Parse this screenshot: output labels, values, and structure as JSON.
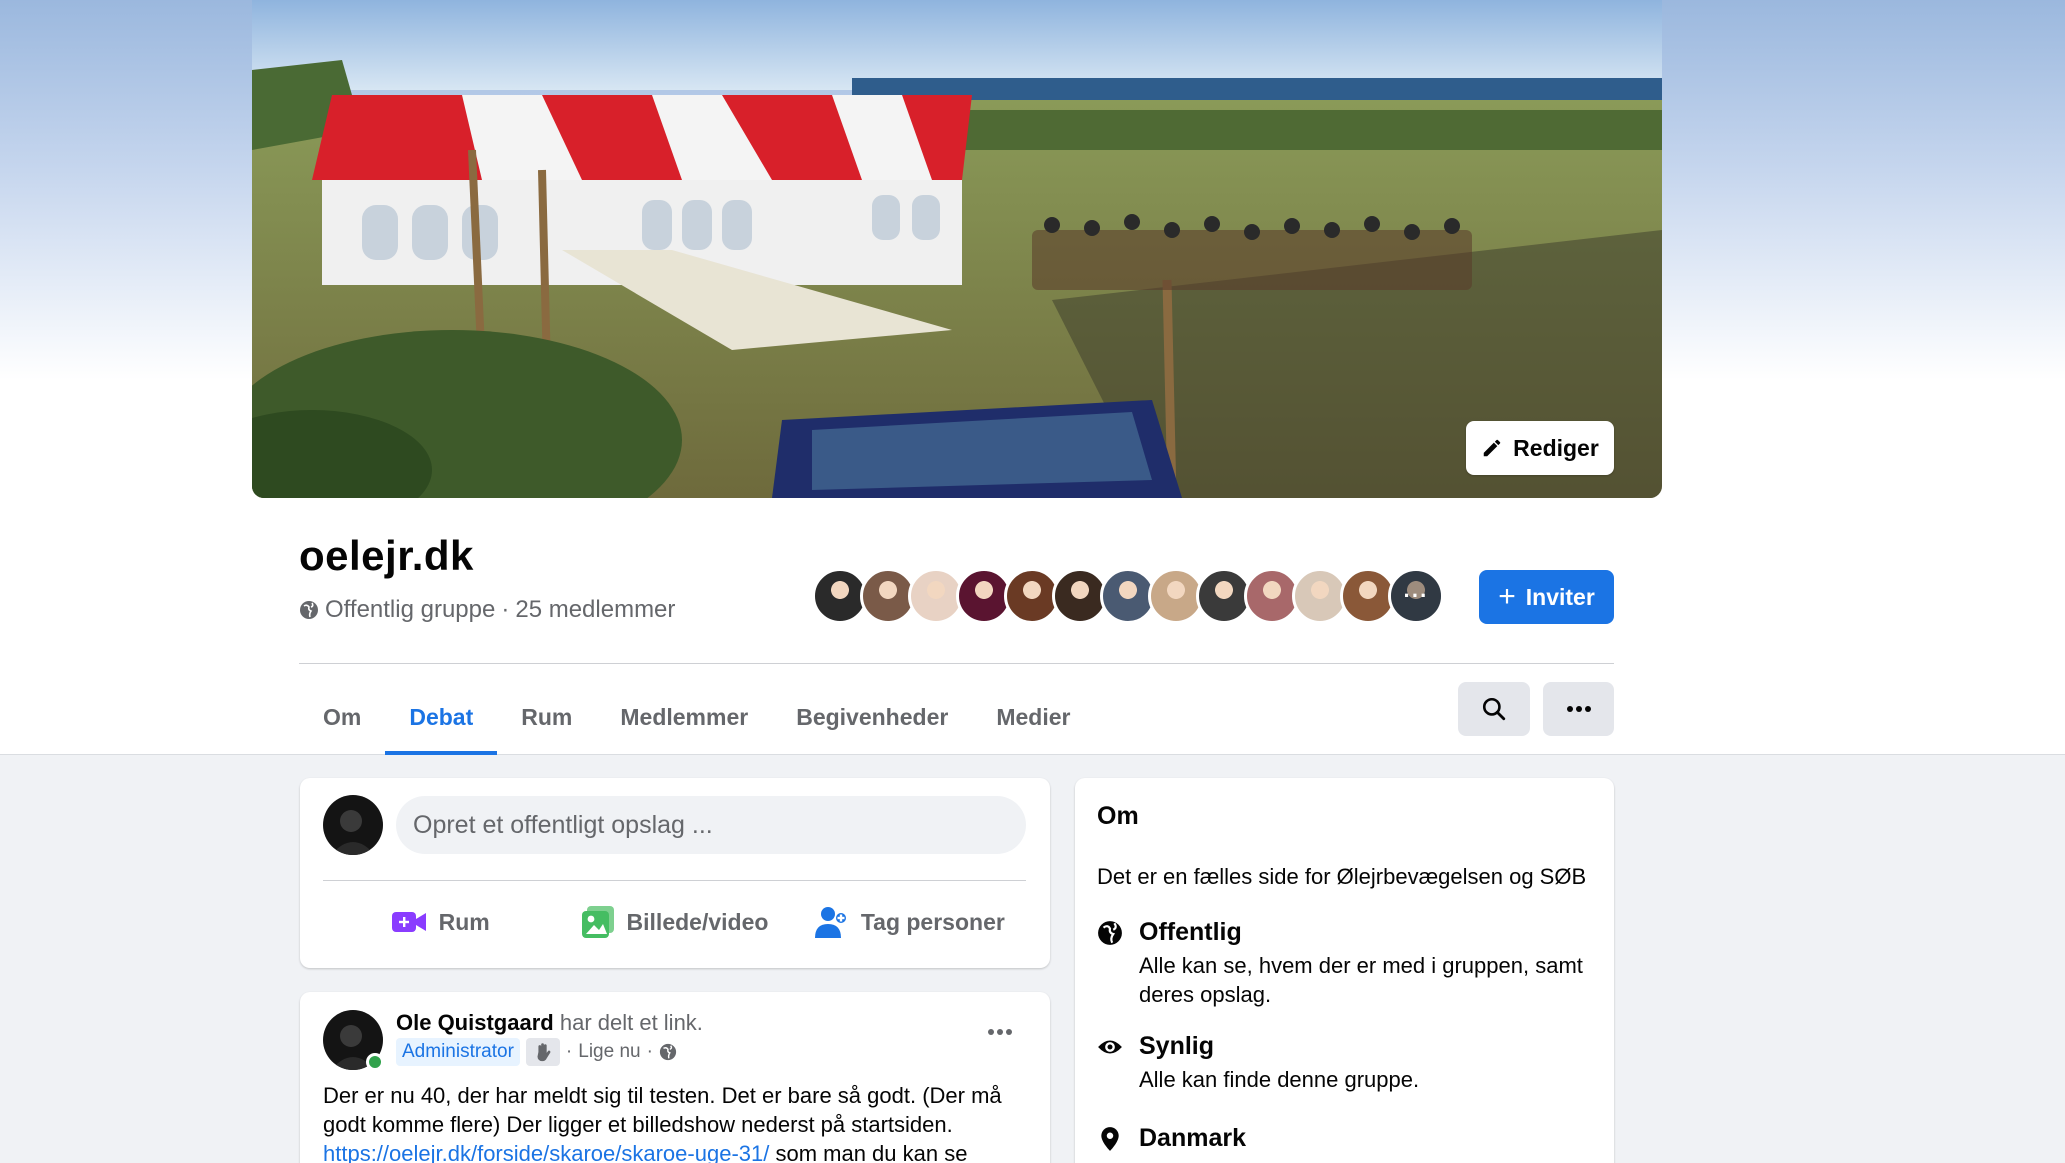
{
  "cover": {
    "edit_label": "Rediger"
  },
  "group": {
    "name": "oelejr.dk",
    "privacy": "Offentlig gruppe",
    "separator": "·",
    "members": "25 medlemmer",
    "invite_label": "Inviter",
    "member_avatars": [
      "#2a2a2a",
      "#7a5a48",
      "#e8d2c4",
      "#5a1430",
      "#6a3a24",
      "#3a2a20",
      "#4a5a72",
      "#c8a888",
      "#3a3a3a",
      "#a8686a",
      "#d8c8b8",
      "#8a5838",
      "#4a5868"
    ]
  },
  "tabs": [
    {
      "label": "Om",
      "active": false
    },
    {
      "label": "Debat",
      "active": true
    },
    {
      "label": "Rum",
      "active": false
    },
    {
      "label": "Medlemmer",
      "active": false
    },
    {
      "label": "Begivenheder",
      "active": false
    },
    {
      "label": "Medier",
      "active": false
    }
  ],
  "composer": {
    "placeholder": "Opret et offentligt opslag ...",
    "actions": [
      {
        "label": "Rum",
        "icon": "video-camera-plus-icon",
        "color": "#8a3cff"
      },
      {
        "label": "Billede/video",
        "icon": "photo-icon",
        "color": "#45bd62"
      },
      {
        "label": "Tag personer",
        "icon": "tag-people-icon",
        "color": "#1b74e4"
      }
    ]
  },
  "post": {
    "author": "Ole Quistgaard",
    "action_text": "har delt et link.",
    "role": "Administrator",
    "time": "Lige nu",
    "dot": "·",
    "body_line1": "Der er nu 40, der har meldt sig til testen. Det er bare så godt. (Der må godt komme flere) Der ligger et billedshow nederst på startsiden.",
    "link": "https://oelejr.dk/forside/skaroe/skaroe-uge-31/",
    "body_after_link": " som man du kan se"
  },
  "about": {
    "heading": "Om",
    "description": "Det er en fælles side for Ølejrbevægelsen og SØB",
    "items": [
      {
        "title": "Offentlig",
        "text": "Alle kan se, hvem der er med i gruppen, samt deres opslag.",
        "icon": "globe-icon"
      },
      {
        "title": "Synlig",
        "text": "Alle kan finde denne gruppe.",
        "icon": "eye-icon"
      },
      {
        "title": "Danmark",
        "text": "",
        "icon": "location-pin-icon"
      }
    ]
  },
  "colors": {
    "accent": "#1b74e4",
    "secondary_text": "#65676b",
    "page_bg": "#f0f2f5",
    "online": "#31a24c"
  }
}
